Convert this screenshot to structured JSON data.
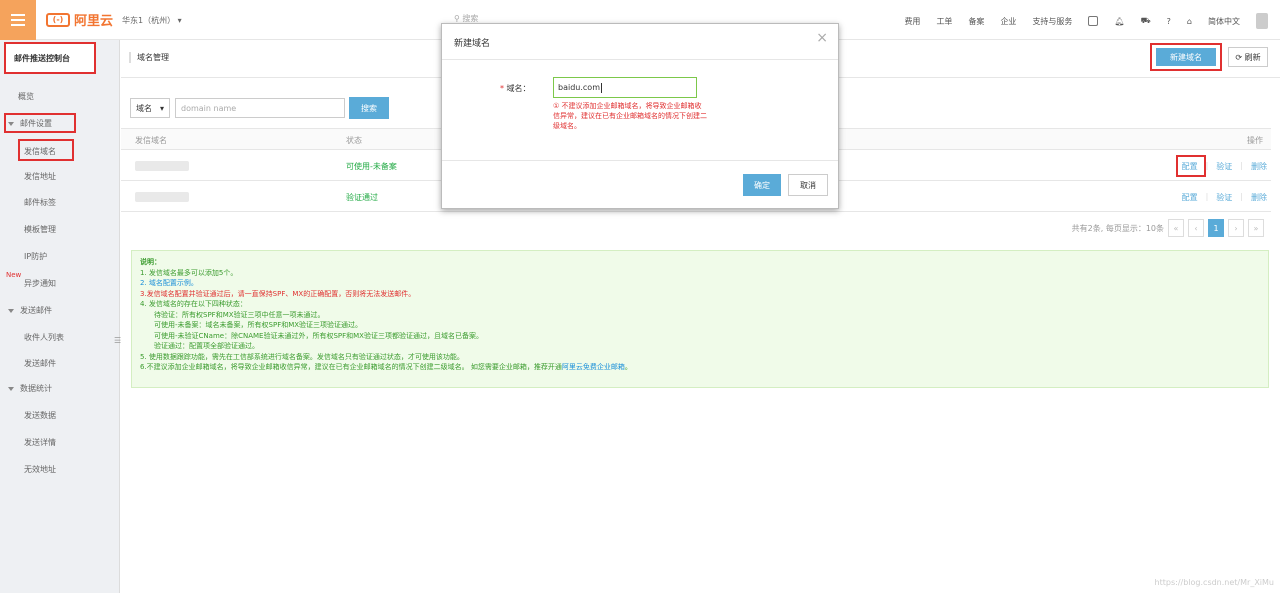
{
  "topbar": {
    "logo_text": "阿里云",
    "logo_mark": "(-)",
    "region": "华东1（杭州）",
    "search_placeholder": "搜索",
    "links": [
      "费用",
      "工单",
      "备案",
      "企业",
      "支持与服务"
    ],
    "language": "简体中文"
  },
  "sidebar": {
    "title": "邮件推送控制台",
    "overview": "概览",
    "group_mail_settings": "邮件设置",
    "items_mail_settings": [
      "发信域名",
      "发信地址",
      "邮件标签",
      "模板管理",
      "IP防护"
    ],
    "new_tag": "New",
    "async_notify": "异步通知",
    "group_send_mail": "发送邮件",
    "items_send_mail": [
      "收件人列表",
      "发送邮件"
    ],
    "group_stats": "数据统计",
    "items_stats": [
      "发送数据",
      "发送详情",
      "无效地址"
    ],
    "collapse_glyph": "☰"
  },
  "main": {
    "page_title": "域名管理",
    "new_domain_btn": "新建域名",
    "refresh_btn": "刷新",
    "filter_select": "域名",
    "filter_placeholder": "domain name",
    "search_btn": "搜索",
    "columns": {
      "domain": "发信域名",
      "status": "状态",
      "ops": "操作"
    },
    "rows": [
      {
        "status": "可使用-未备案",
        "ops": [
          "配置",
          "验证",
          "删除"
        ]
      },
      {
        "status": "验证通过",
        "ops": [
          "配置",
          "验证",
          "删除"
        ]
      }
    ],
    "pager_text": "共有2条, 每页显示：10条",
    "pager_current": "1",
    "pager_prev_prev": "«",
    "pager_prev": "‹",
    "pager_next": "›",
    "pager_next_next": "»"
  },
  "notes": {
    "heading": "说明：",
    "lines": [
      "1. 发信域名最多可以添加5个。",
      "2. 域名配置示例。",
      "3.发信域名配置并验证通过后，请一直保持SPF、MX的正确配置，否则将无法发送邮件。",
      "4. 发信域名的存在以下四种状态：",
      "待验证：所有权SPF和MX验证三项中任意一项未通过。",
      "可使用-未备案：域名未备案，所有权SPF和MX验证三项验证通过。",
      "可使用-未验证CName：除CNAME验证未通过外，所有权SPF和MX验证三项都验证通过，且域名已备案。",
      "验证通过：配置项全部验证通过。",
      "5. 使用数据跟踪功能，需先在工信部系统进行域名备案。发信域名只有验证通过状态，才可使用该功能。",
      "6.不建议添加企业邮箱域名，将导致企业邮箱收信异常，建议在已有企业邮箱域名的情况下创建二级域名。 如您需要企业邮箱，推荐开通",
      "阿里云免费企业邮箱",
      "。"
    ]
  },
  "modal": {
    "title": "新建域名",
    "close_glyph": "×",
    "field_star": "*",
    "field_label": "域名：",
    "field_value": "baidu.com",
    "error_text": "① 不建议添加企业邮箱域名，将导致企业邮箱收信异常，建议在已有企业邮箱域名的情况下创建二级域名。",
    "ok_btn": "确定",
    "cancel_btn": "取消"
  },
  "watermark": "https://blog.csdn.net/Mr_XiMu",
  "colors": {
    "accent": "#5aabd8",
    "brand": "#f27531",
    "highlight": "#e03030",
    "success": "#22aa44"
  }
}
